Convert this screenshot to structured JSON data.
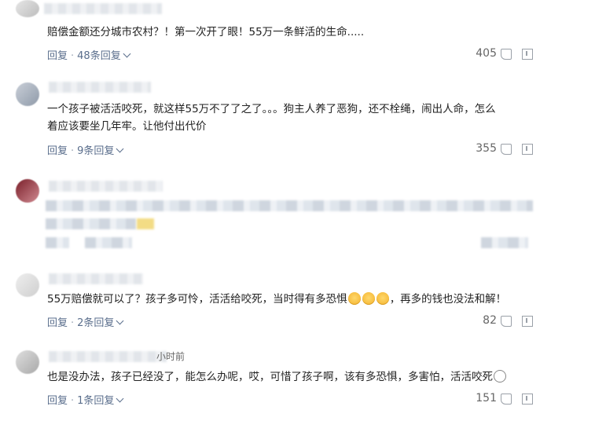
{
  "comments": [
    {
      "text": "赔偿金额还分城市农村？！第一次开了眼！55万一条鲜活的生命.....",
      "reply_label": "回复",
      "replies_label": "48条回复",
      "likes": "405"
    },
    {
      "text": "一个孩子被活活咬死，就这样55万不了了之了。。。狗主人养了恶狗，还不栓绳，闹出人命，怎么\n着应该要坐几年牢。让他付出代价",
      "reply_label": "回复",
      "replies_label": "9条回复",
      "likes": "355"
    },
    {
      "text": "",
      "reply_label": "",
      "replies_label": "",
      "likes": ""
    },
    {
      "text_before": "55万赔偿就可以了？孩子多可怜，活活给咬死，当时得有多恐惧",
      "text_after": "，再多的钱也没法和解！",
      "reply_label": "回复",
      "replies_label": "2条回复",
      "likes": "82"
    },
    {
      "time": "小时前",
      "text": "也是没办法，孩子已经没了，能怎么办呢，哎，可惜了孩子啊，该有多恐惧，多害怕，活活咬死",
      "reply_label": "回复",
      "replies_label": "1条回复",
      "likes": "151"
    }
  ],
  "icons": {
    "like": "thumbs-up-icon",
    "report": "report-icon",
    "emoji": "crying-face-emoji"
  },
  "colors": {
    "action_link": "#5a6e8c",
    "text": "#222222",
    "muted": "#666666"
  }
}
